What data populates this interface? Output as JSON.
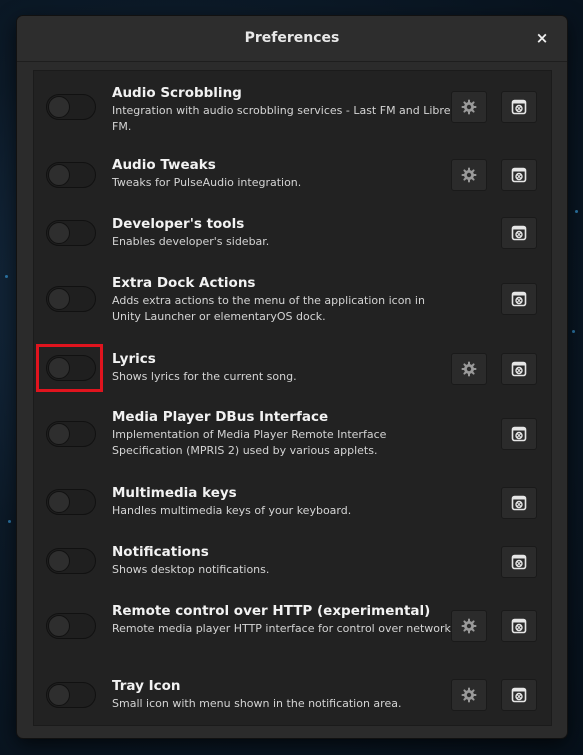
{
  "window": {
    "title": "Preferences",
    "close_label": "×"
  },
  "plugins": [
    {
      "name": "Audio Scrobbling",
      "description": "Integration with audio scrobbling services - Last FM and Libre FM.",
      "enabled": false,
      "has_settings": true
    },
    {
      "name": "Audio Tweaks",
      "description": "Tweaks for PulseAudio integration.",
      "enabled": false,
      "has_settings": true
    },
    {
      "name": "Developer's tools",
      "description": "Enables developer's sidebar.",
      "enabled": false,
      "has_settings": false
    },
    {
      "name": "Extra Dock Actions",
      "description": "Adds extra actions to the menu of the application icon in Unity Launcher or elementaryOS dock.",
      "enabled": false,
      "has_settings": false
    },
    {
      "name": "Lyrics",
      "description": "Shows lyrics for the current song.",
      "enabled": false,
      "has_settings": true,
      "highlighted": true
    },
    {
      "name": "Media Player DBus Interface",
      "description": "Implementation of Media Player Remote Interface Specification (MPRIS 2) used by various applets.",
      "enabled": false,
      "has_settings": false
    },
    {
      "name": "Multimedia keys",
      "description": "Handles multimedia keys of your keyboard.",
      "enabled": false,
      "has_settings": false
    },
    {
      "name": "Notifications",
      "description": "Shows desktop notifications.",
      "enabled": false,
      "has_settings": false
    },
    {
      "name": "Remote control over HTTP (experimental)",
      "description": "Remote media player HTTP interface for control over network.",
      "enabled": false,
      "has_settings": true
    },
    {
      "name": "Tray Icon",
      "description": "Small icon with menu shown in the notification area.",
      "enabled": false,
      "has_settings": true
    }
  ],
  "icons": {
    "settings": "gear-icon",
    "about": "about-icon"
  },
  "colors": {
    "highlight": "#e0141e",
    "window_bg": "#2b2b2b",
    "list_bg": "#222222"
  }
}
